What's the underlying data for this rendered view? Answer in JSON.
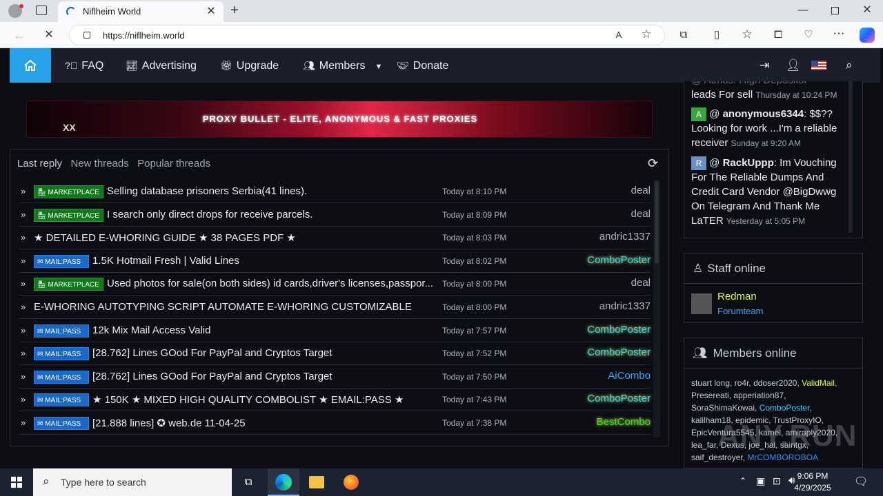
{
  "browser": {
    "tab_title": "Niflheim World",
    "url": "https://niflheim.world"
  },
  "nav": {
    "items": [
      {
        "label": "FAQ"
      },
      {
        "label": "Advertising"
      },
      {
        "label": "Upgrade"
      },
      {
        "label": "Members"
      },
      {
        "label": "Donate"
      }
    ]
  },
  "banner": {
    "text": "PROXY BULLET - ELITE, ANONYMOUS & FAST PROXIES",
    "tag": "XX"
  },
  "threads": {
    "tabs": [
      "Last reply",
      "New threads",
      "Popular threads"
    ],
    "rows": [
      {
        "badge": "MARKETPLACE",
        "badge_type": "marketplace",
        "title": "Selling database prisoners Serbia(41 lines).",
        "time": "Today at 8:10 PM",
        "user": "deal",
        "user_style": "plain"
      },
      {
        "badge": "MARKETPLACE",
        "badge_type": "marketplace",
        "title": "I search only direct drops for receive parcels.",
        "time": "Today at 8:09 PM",
        "user": "deal",
        "user_style": "plain"
      },
      {
        "badge": "",
        "badge_type": "none",
        "title": "★ DETAILED E-WHORING GUIDE ★ 38 PAGES PDF ★",
        "time": "Today at 8:03 PM",
        "user": "andric1337",
        "user_style": "plain"
      },
      {
        "badge": "MAIL:PASS",
        "badge_type": "mailpass",
        "title": "1.5K Hotmail Fresh | Valid Lines",
        "time": "Today at 8:02 PM",
        "user": "ComboPoster",
        "user_style": "combo"
      },
      {
        "badge": "MARKETPLACE",
        "badge_type": "marketplace",
        "title": "Used photos for sale(on both sides) id cards,driver's licenses,passpor...",
        "time": "Today at 8:00 PM",
        "user": "deal",
        "user_style": "plain"
      },
      {
        "badge": "",
        "badge_type": "none",
        "title": "E-WHORING AUTOTYPING SCRIPT AUTOMATE E-WHORING CUSTOMIZABLE",
        "time": "Today at 8:00 PM",
        "user": "andric1337",
        "user_style": "plain"
      },
      {
        "badge": "MAIL:PASS",
        "badge_type": "mailpass",
        "title": "12k Mix Mail Access Valid",
        "time": "Today at 7:57 PM",
        "user": "ComboPoster",
        "user_style": "combo"
      },
      {
        "badge": "MAIL:PASS",
        "badge_type": "mailpass",
        "title": "[28.762] Lines GOod For PayPal and Cryptos Target",
        "time": "Today at 7:52 PM",
        "user": "ComboPoster",
        "user_style": "combo"
      },
      {
        "badge": "MAIL:PASS",
        "badge_type": "mailpass",
        "title": "[28.762] Lines GOod For PayPal and Cryptos Target",
        "time": "Today at 7:50 PM",
        "user": "AiCombo",
        "user_style": "ai"
      },
      {
        "badge": "MAIL:PASS",
        "badge_type": "mailpass",
        "title": "★ 150K ★ MIXED HIGH QUALITY COMBOLIST ★ EMAIL:PASS ★",
        "time": "Today at 7:43 PM",
        "user": "ComboPoster",
        "user_style": "combo"
      },
      {
        "badge": "MAIL:PASS",
        "badge_type": "mailpass",
        "title": "[21.888 lines] ✪ web.de 11-04-25",
        "time": "Today at 7:38 PM",
        "user": "BestCombo",
        "user_style": "best"
      }
    ]
  },
  "shoutbox": {
    "partial": {
      "text": "leads For sell",
      "time": "Thursday at 10:24 PM"
    },
    "entries": [
      {
        "avatar": "A",
        "avatar_color": "#3aa640",
        "name": "anonymous6344",
        "text": ": $$?? Looking for work ...I'm a reliable receiver",
        "time": "Sunday at 9:20 AM"
      },
      {
        "avatar": "R",
        "avatar_color": "#6d8fc4",
        "name": "RackUppp",
        "text": ": Im Vouching For The Reliable Dumps And Credit Card Vendor @BigDwwg On Telegram And Thank Me LaTER",
        "time": "Yesterday at 5:05 PM"
      }
    ]
  },
  "staff": {
    "title": "Staff online",
    "members": [
      {
        "name": "Redman",
        "role": "Forumteam"
      }
    ]
  },
  "members_online": {
    "title": "Members online",
    "names": [
      {
        "n": "stuart long",
        "c": "#c6cdd8"
      },
      {
        "n": "ro4r",
        "c": "#c6cdd8"
      },
      {
        "n": "ddoser2020",
        "c": "#c6cdd8"
      },
      {
        "n": "ValidMail",
        "c": "#d7ff3a"
      },
      {
        "n": "Presereati",
        "c": "#c6cdd8"
      },
      {
        "n": "apperiation87",
        "c": "#c6cdd8"
      },
      {
        "n": "SoraShimaKowai",
        "c": "#c6cdd8"
      },
      {
        "n": "ComboPoster",
        "c": "#41d0ff"
      },
      {
        "n": "kalilham18",
        "c": "#c6cdd8"
      },
      {
        "n": "epidemic",
        "c": "#c6cdd8"
      },
      {
        "n": "TrustProxyIO",
        "c": "#c6cdd8"
      },
      {
        "n": "EpicVentura5545",
        "c": "#c6cdd8"
      },
      {
        "n": "kamel",
        "c": "#c6cdd8"
      },
      {
        "n": "amiraply2020",
        "c": "#c6cdd8"
      },
      {
        "n": "lea_far",
        "c": "#c6cdd8"
      },
      {
        "n": "Dexus",
        "c": "#c6cdd8"
      },
      {
        "n": "joe_hal",
        "c": "#c6cdd8"
      },
      {
        "n": "saintgx",
        "c": "#c6cdd8"
      },
      {
        "n": "saif_destroyer",
        "c": "#c6cdd8"
      },
      {
        "n": "MrCOMBOROBOA",
        "c": "#3a8cff"
      }
    ]
  },
  "taskbar": {
    "search_placeholder": "Type here to search",
    "time": "9:06 PM",
    "date": "4/29/2025"
  },
  "watermark": "ANY.RUN"
}
